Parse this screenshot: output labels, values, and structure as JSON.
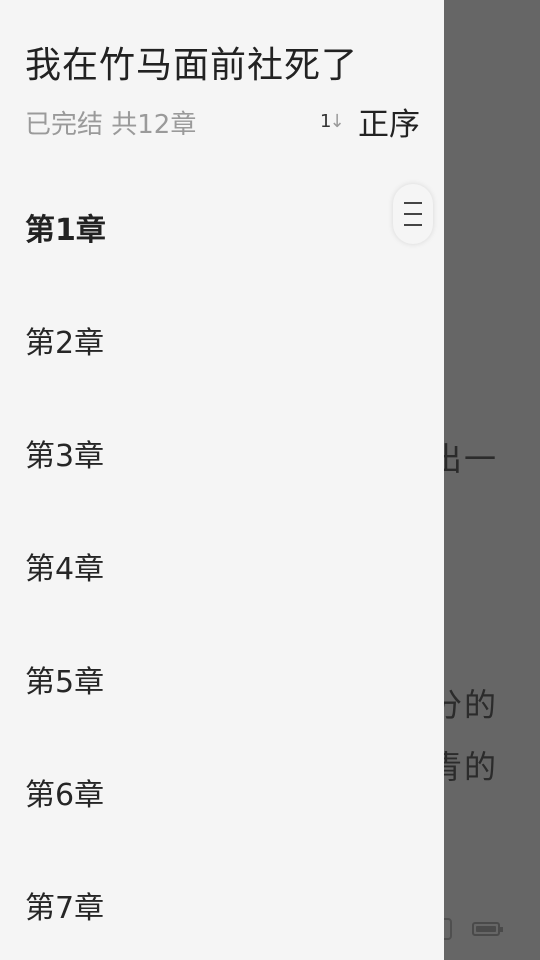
{
  "book": {
    "title": "我在竹马面前社死了",
    "meta": "已完结 共12章"
  },
  "sort": {
    "icon": "sort-ascending-icon",
    "icon_up": "1",
    "icon_down": "↓",
    "label": "正序"
  },
  "chapters": [
    {
      "label": "第1章",
      "current": true
    },
    {
      "label": "第2章",
      "current": false
    },
    {
      "label": "第3章",
      "current": false
    },
    {
      "label": "第4章",
      "current": false
    },
    {
      "label": "第5章",
      "current": false
    },
    {
      "label": "第6章",
      "current": false
    },
    {
      "label": "第7章",
      "current": false
    }
  ],
  "scroll_handle": {
    "icon": "drag-handle-icon"
  },
  "background_page": {
    "line_1": "出一",
    "line_2": "分的",
    "line_3": "青的"
  },
  "colors": {
    "drawer_bg": "#f5f5f5",
    "overlay": "#666666",
    "text_primary": "#222222",
    "text_secondary": "#9a9a9a"
  }
}
